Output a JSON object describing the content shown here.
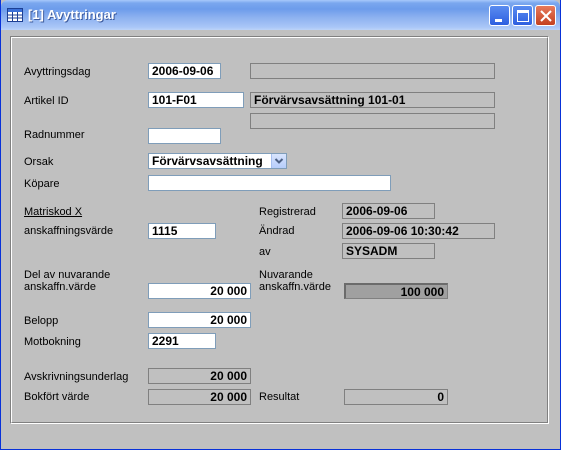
{
  "window": {
    "title": "[1]  Avyttringar",
    "icon": "table-icon",
    "buttons": [
      "minimize-icon",
      "maximize-icon",
      "close-icon"
    ]
  },
  "form": {
    "avyttringsdag": {
      "label": "Avyttringsdag",
      "value": "2006-09-06",
      "info": ""
    },
    "artikel": {
      "label": "Artikel ID",
      "value": "101-F01",
      "description": "Förvärvsavsättning 101-01",
      "extra": ""
    },
    "radnummer": {
      "label": "Radnummer",
      "value": ""
    },
    "orsak": {
      "label": "Orsak",
      "value": "Förvärvsavsättning"
    },
    "kopare": {
      "label": "Köpare",
      "value": ""
    },
    "matriskod": {
      "label": "Matriskod X",
      "sublabel": "anskaffningsvärde",
      "value": "1115"
    },
    "registrerad": {
      "label": "Registrerad",
      "value": "2006-09-06"
    },
    "andrad": {
      "label": "Ändrad",
      "value": "2006-09-06 10:30:42"
    },
    "av": {
      "label": "av",
      "value": "SYSADM"
    },
    "del_av": {
      "label1": "Del av nuvarande",
      "label2": "anskaffn.värde",
      "value": "20 000"
    },
    "nuvarande": {
      "label1": "Nuvarande",
      "label2": "anskaffn.värde",
      "value": "100 000"
    },
    "belopp": {
      "label": "Belopp",
      "value": "20 000"
    },
    "motbokning": {
      "label": "Motbokning",
      "value": "2291"
    },
    "avskrivningsunderlag": {
      "label": "Avskrivningsunderlag",
      "value": "20 000"
    },
    "bokfort": {
      "label": "Bokfört värde",
      "value": "20 000"
    },
    "resultat": {
      "label": "Resultat",
      "value": "0"
    }
  },
  "colors": {
    "titlebar": "#7aa7ef",
    "client": "#c0c0c0",
    "close_button": "#c4401f"
  }
}
